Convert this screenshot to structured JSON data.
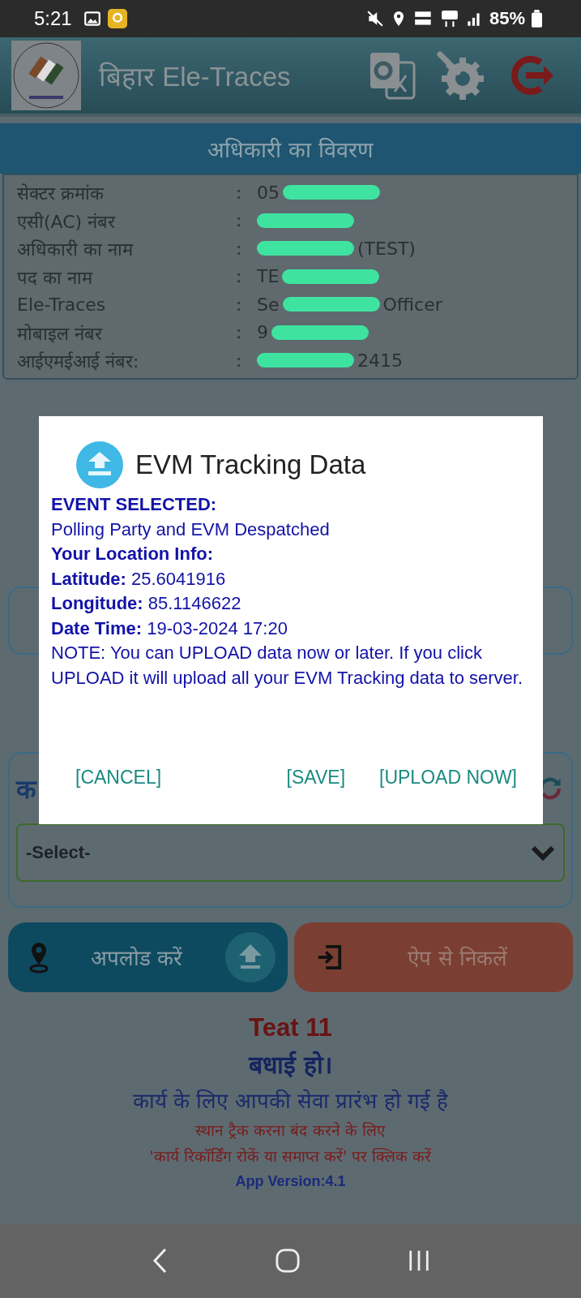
{
  "status_bar": {
    "time": "5:21",
    "battery": "85%"
  },
  "app_bar": {
    "title": "बिहार Ele-Traces"
  },
  "officer_details": {
    "title": "अधिकारी का विवरण",
    "rows": [
      {
        "label": "सेक्टर क्रमांक",
        "separator": ":",
        "value_start": "05",
        "masked": true
      },
      {
        "label": "एसी(AC) नंबर",
        "separator": ":",
        "masked": true
      },
      {
        "label": "अधिकारी का नाम",
        "separator": ":",
        "value_end": "(TEST)",
        "masked": true
      },
      {
        "label": "पद का नाम",
        "separator": ":",
        "value_start": "TE",
        "masked": true
      },
      {
        "label": "Ele-Traces",
        "separator": ":",
        "value_start": "Se",
        "value_end": "Officer",
        "masked": true
      },
      {
        "label": "मोबाइल नंबर",
        "separator": ":",
        "value_start": "9",
        "masked": true
      },
      {
        "label": "आईएमईआई नंबर:",
        "separator": ":",
        "value_end": "2415",
        "masked": true
      }
    ]
  },
  "event_panel": {
    "label_start": "क",
    "select": {
      "value": "-Select-"
    }
  },
  "actions": [
    {
      "kind": "upload",
      "label": "अपलोड करें"
    },
    {
      "kind": "exit",
      "label": "ऐप से निकलें"
    }
  ],
  "messages": [
    {
      "kind": "name",
      "text": "Teat 11"
    },
    {
      "kind": "greeting",
      "text": "बधाई हो।"
    },
    {
      "kind": "info",
      "text": "कार्य के लिए आपकी सेवा प्रारंभ हो गई है"
    },
    {
      "kind": "warning",
      "text": "स्थान ट्रैक करना बंद करने के लिए"
    },
    {
      "kind": "warning",
      "text": "'कार्य रिकॉर्डिंग रोकें या समाप्त करें' पर क्लिक करें"
    },
    {
      "kind": "version",
      "text": "App Version:4.1"
    }
  ],
  "dialog": {
    "title": "EVM Tracking Data",
    "lines": [
      {
        "kind": "heading",
        "text": "EVENT SELECTED:"
      },
      {
        "kind": "text",
        "text": "Polling Party and EVM Despatched"
      },
      {
        "kind": "heading",
        "text": "Your Location Info:"
      },
      {
        "kind": "field",
        "label": "Latitude:",
        "value": "25.6041916"
      },
      {
        "kind": "field",
        "label": "Longitude:",
        "value": "85.1146622"
      },
      {
        "kind": "field",
        "label": "Date Time:",
        "value": "19-03-2024 17:20"
      },
      {
        "kind": "text",
        "text": "NOTE: You can UPLOAD data now or later. If you click UPLOAD it will upload all your EVM Tracking data to server."
      }
    ],
    "buttons": [
      "[CANCEL]",
      "[SAVE]",
      "[UPLOAD NOW]"
    ]
  }
}
